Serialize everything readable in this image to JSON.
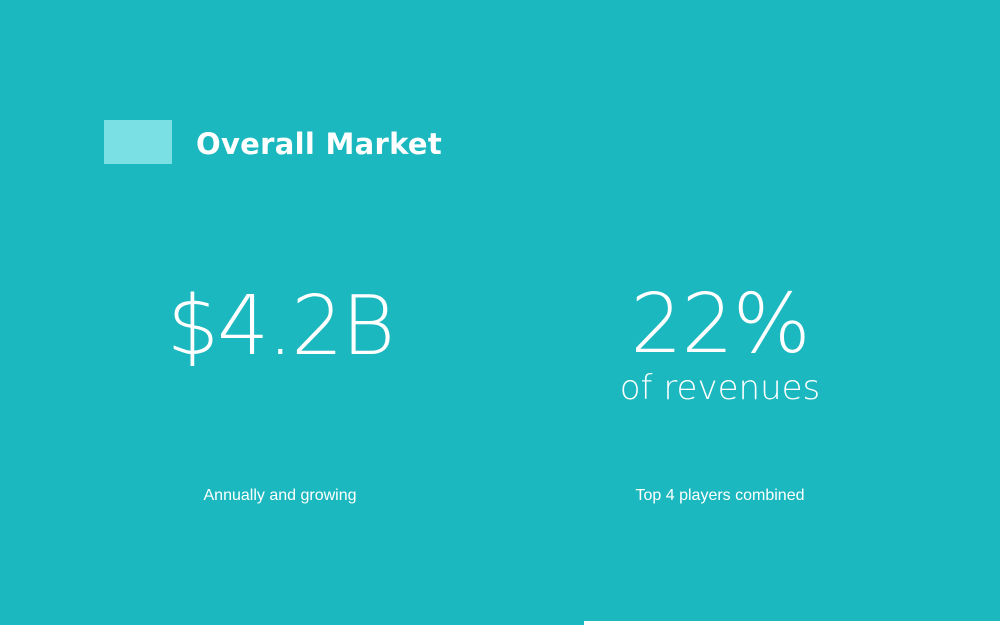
{
  "slide": {
    "title": "Overall Market",
    "background_color": "#1cb8c0",
    "accent_color": "#7be0e4"
  },
  "stats": [
    {
      "value": "$4.2B",
      "sub": "",
      "caption": "Annually and growing"
    },
    {
      "value": "22%",
      "sub": "of revenues",
      "caption": "Top 4 players combined"
    }
  ]
}
